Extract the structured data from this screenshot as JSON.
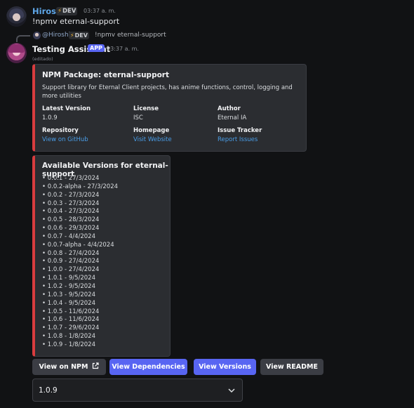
{
  "message1": {
    "username": "Hiroshi",
    "badge": "DEV",
    "timestamp": "03:37 a. m.",
    "content": "!npmv eternal-support",
    "colors": {
      "username": "#5fa7e9"
    }
  },
  "reply": {
    "username": "@Hiroshi",
    "badge": "DEV",
    "content": "!npmv eternal-support"
  },
  "message2": {
    "username": "Testing Assistant",
    "app_badge": "APP",
    "timestamp": "03:37 a. m.",
    "edited": "(editado)"
  },
  "embed1": {
    "title": "NPM Package: eternal-support",
    "description": "Support library for Eternal Client projects, has anime functions, control, logging and more utilities",
    "fields": {
      "latest_version": {
        "name": "Latest Version",
        "value": "1.0.9"
      },
      "license": {
        "name": "License",
        "value": "ISC"
      },
      "author": {
        "name": "Author",
        "value": "Eternal IA"
      },
      "repository": {
        "name": "Repository",
        "value": "View on GitHub"
      },
      "homepage": {
        "name": "Homepage",
        "value": "Visit Website"
      },
      "issue_tracker": {
        "name": "Issue Tracker",
        "value": "Report Issues"
      }
    },
    "accent_color": "#d83c3e"
  },
  "embed2": {
    "title": "Available Versions for eternal-support",
    "versions": [
      "• 0.0.1 - 27/3/2024",
      "• 0.0.2-alpha - 27/3/2024",
      "• 0.0.2 - 27/3/2024",
      "• 0.0.3 - 27/3/2024",
      "• 0.0.4 - 27/3/2024",
      "• 0.0.5 - 28/3/2024",
      "• 0.0.6 - 29/3/2024",
      "• 0.0.7 - 4/4/2024",
      "• 0.0.7-alpha - 4/4/2024",
      "• 0.0.8 - 27/4/2024",
      "• 0.0.9 - 27/4/2024",
      "• 1.0.0 - 27/4/2024",
      "• 1.0.1 - 9/5/2024",
      "• 1.0.2 - 9/5/2024",
      "• 1.0.3 - 9/5/2024",
      "• 1.0.4 - 9/5/2024",
      "• 1.0.5 - 11/6/2024",
      "• 1.0.6 - 11/6/2024",
      "• 1.0.7 - 29/6/2024",
      "• 1.0.8 - 1/8/2024",
      "• 1.0.9 - 1/8/2024"
    ]
  },
  "buttons": {
    "view_npm": "View on NPM",
    "view_dependencies": "View Dependencies",
    "view_versions": "View Versions",
    "view_readme": "View README",
    "external_icon": "external-link-icon",
    "blurple": "#5865f2"
  },
  "version_select": {
    "selected": "1.0.9",
    "icon": "chevron-down-icon"
  }
}
